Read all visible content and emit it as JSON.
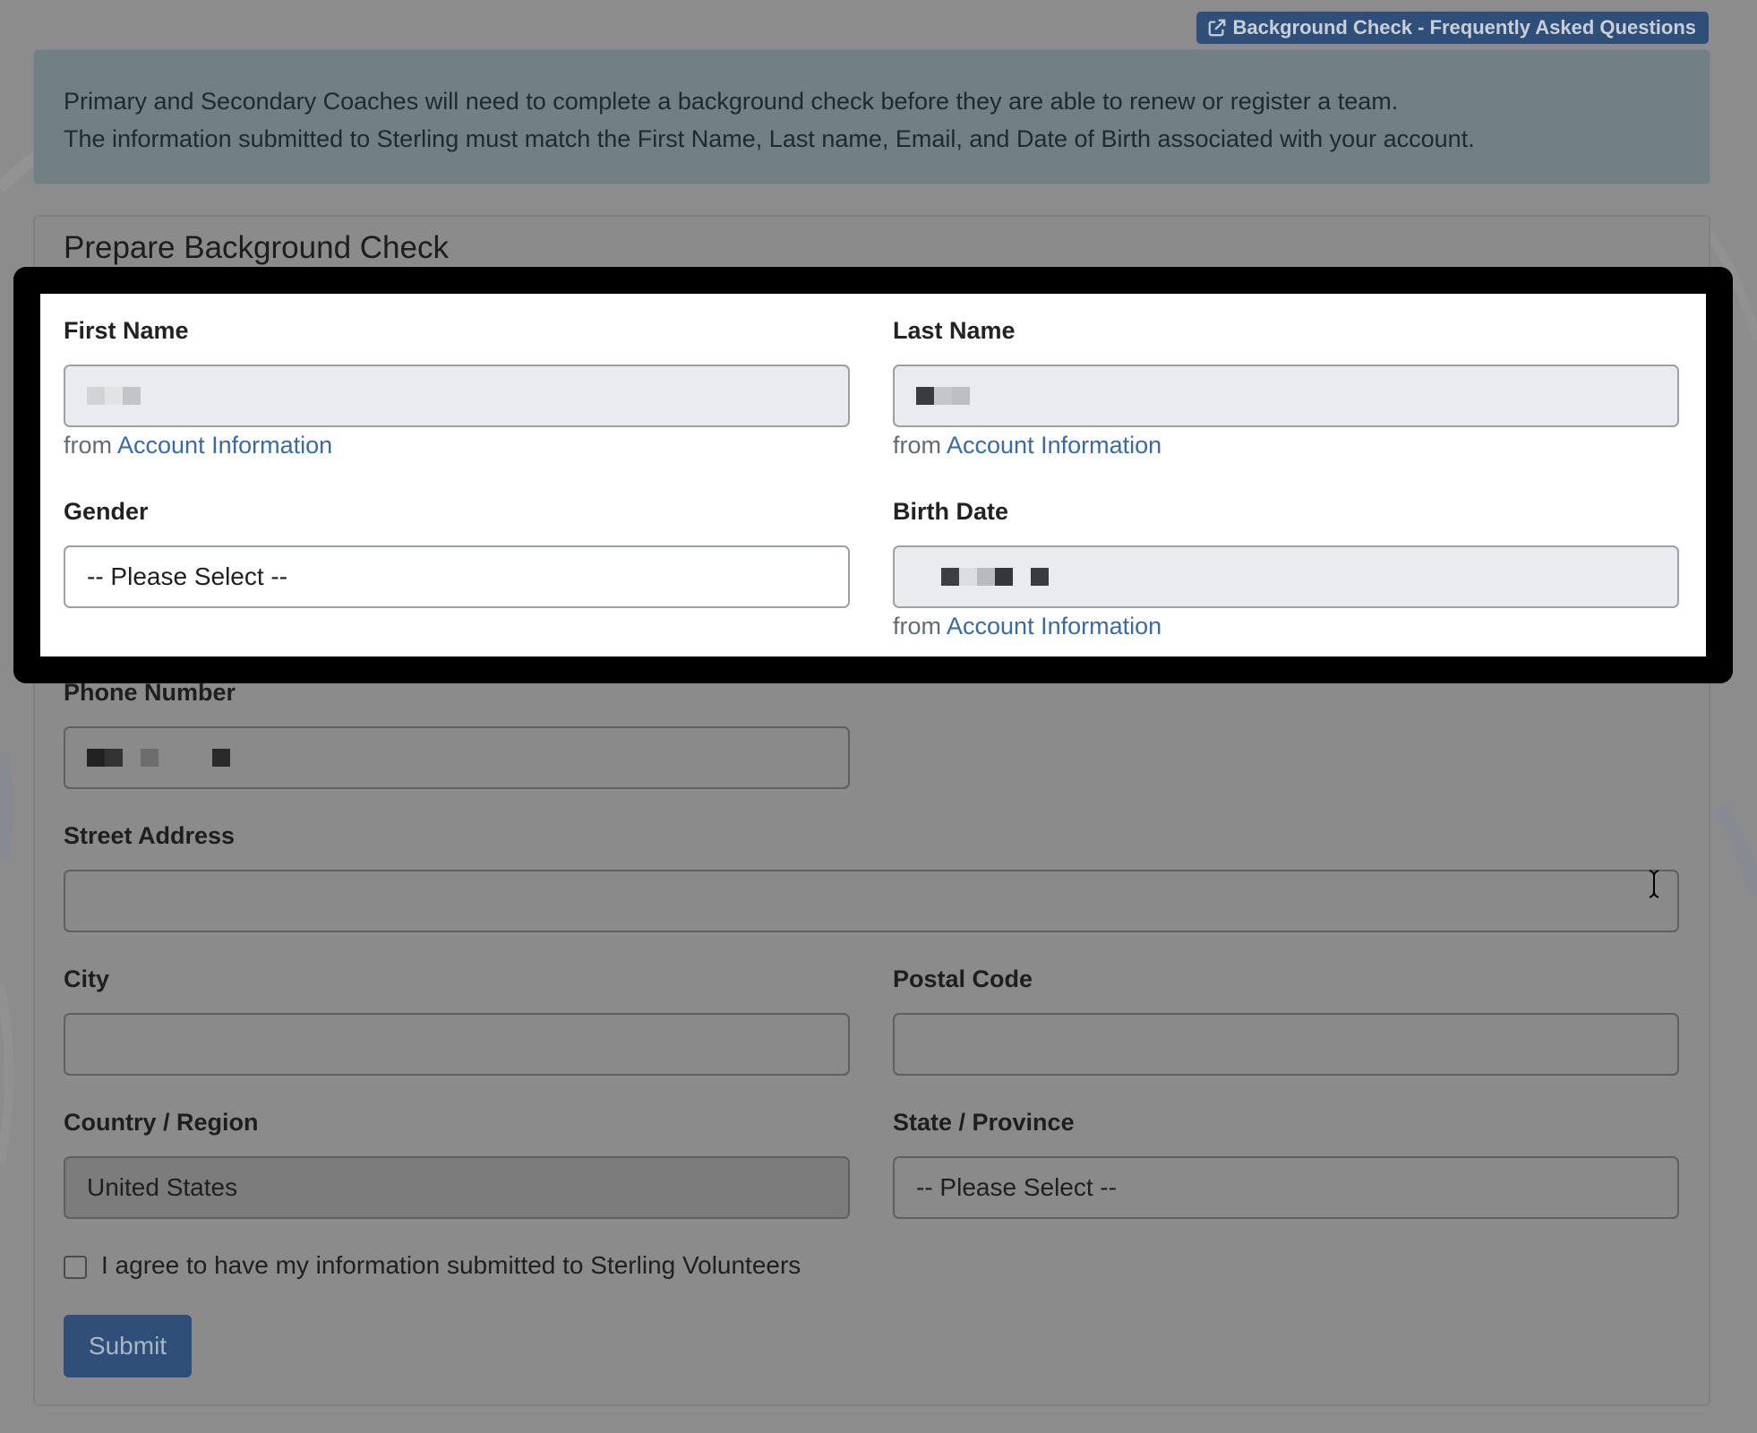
{
  "header": {
    "faq_button_label": "Background Check - Frequently Asked Questions",
    "faq_icon": "external-link-icon"
  },
  "alert": {
    "line1": "Primary and Secondary Coaches will need to complete a background check before they are able to renew or register a team.",
    "line2": "The information submitted to Sterling must match the First Name, Last name, Email, and Date of Birth associated with your account."
  },
  "form": {
    "title": "Prepare Background Check",
    "first_name": {
      "label": "First Name",
      "help_prefix": "from",
      "help_link": "Account Information"
    },
    "last_name": {
      "label": "Last Name",
      "help_prefix": "from",
      "help_link": "Account Information"
    },
    "gender": {
      "label": "Gender",
      "value": "-- Please Select --"
    },
    "birth_date": {
      "label": "Birth Date",
      "help_prefix": "from",
      "help_link": "Account Information"
    },
    "phone": {
      "label": "Phone Number"
    },
    "street": {
      "label": "Street Address",
      "value": ""
    },
    "city": {
      "label": "City",
      "value": ""
    },
    "postal": {
      "label": "Postal Code",
      "value": ""
    },
    "country": {
      "label": "Country / Region",
      "value": "United States"
    },
    "state": {
      "label": "State / Province",
      "value": "-- Please Select --"
    },
    "agree_label": "I agree to have my information submitted to Sterling Volunteers",
    "agree_checked": false,
    "submit_label": "Submit"
  },
  "colors": {
    "primary": "#2f4f78",
    "link": "#3a6aa6",
    "highlight_frame": "#000000"
  }
}
